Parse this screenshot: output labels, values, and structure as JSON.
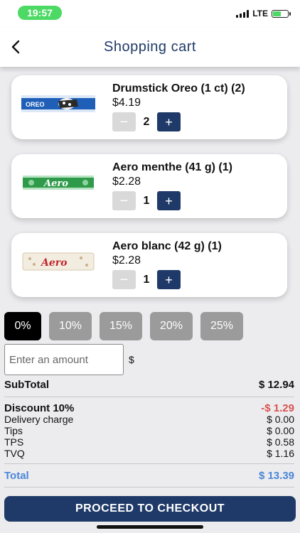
{
  "status_bar": {
    "time": "19:57",
    "network": "LTE"
  },
  "header": {
    "title": "Shopping cart"
  },
  "items": [
    {
      "name": "Drumstick Oreo (1 ct) (2)",
      "price": "$4.19",
      "quantity": "2",
      "minus": "−",
      "plus": "+",
      "image": "oreo-drumstick"
    },
    {
      "name": "Aero menthe (41 g) (1)",
      "price": "$2.28",
      "quantity": "1",
      "minus": "−",
      "plus": "+",
      "image": "aero-mint-bar"
    },
    {
      "name": "Aero blanc (42 g) (1)",
      "price": "$2.28",
      "quantity": "1",
      "minus": "−",
      "plus": "+",
      "image": "aero-white-bar"
    }
  ],
  "tips": {
    "options": [
      "0%",
      "10%",
      "15%",
      "20%",
      "25%"
    ],
    "selected": "0%"
  },
  "custom_tip": {
    "placeholder": "Enter an amount",
    "currency": "$"
  },
  "summary": {
    "subtotal_label": "SubTotal",
    "subtotal": "$ 12.94",
    "discount_label": "Discount 10%",
    "discount": "-$ 1.29",
    "delivery_label": "Delivery charge",
    "delivery": "$ 0.00",
    "tips_label": "Tips",
    "tips": "$ 0.00",
    "tps_label": "TPS",
    "tps": "$ 0.58",
    "tvq_label": "TVQ",
    "tvq": "$ 1.16",
    "total_label": "Total",
    "total": "$ 13.39"
  },
  "checkout": {
    "label": "PROCEED TO CHECKOUT"
  },
  "colors": {
    "primary": "#1f3a68",
    "discount": "#d9534f",
    "total": "#4a86d6",
    "tip_selected": "#000000",
    "tip_default": "#9b9b9b"
  }
}
